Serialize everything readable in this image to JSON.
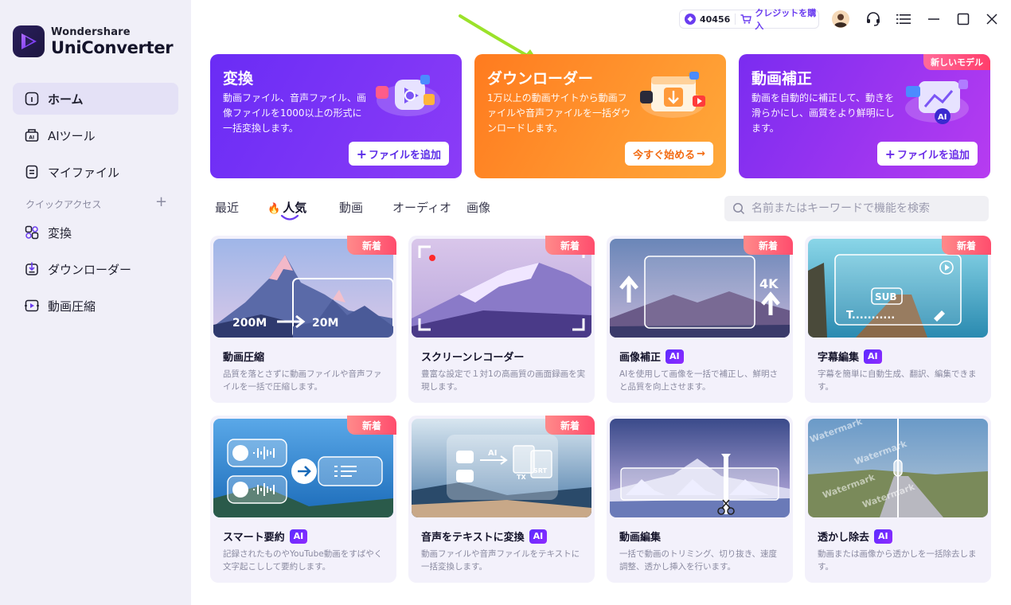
{
  "app": {
    "brand_small": "Wondershare",
    "brand_big": "UniConverter"
  },
  "sidebar": {
    "items": [
      {
        "label": "ホーム",
        "icon": "home-icon"
      },
      {
        "label": "AIツール",
        "icon": "ai-tools-icon"
      },
      {
        "label": "マイファイル",
        "icon": "my-files-icon"
      }
    ],
    "quick_access_label": "クイックアクセス",
    "quick_add": "+",
    "quick_items": [
      {
        "label": "変換",
        "icon": "convert-icon"
      },
      {
        "label": "ダウンローダー",
        "icon": "downloader-icon"
      },
      {
        "label": "動画圧縮",
        "icon": "compress-icon"
      }
    ]
  },
  "titlebar": {
    "credits": "40456",
    "buy_credits": "クレジットを購入"
  },
  "hero": [
    {
      "title": "変換",
      "desc": "動画ファイル、音声ファイル、画像ファイルを1000以上の形式に一括変換します。",
      "button": "ファイルを追加",
      "button_prefix": "+",
      "color_from": "#6a2cf5",
      "color_to": "#8b3cf7",
      "button_color": "#5b2de8"
    },
    {
      "title": "ダウンローダー",
      "desc": "1万以上の動画サイトから動画ファイルや音声ファイルを一括ダウンロードします。",
      "button": "今すぐ始める",
      "button_suffix": "→",
      "color_from": "#ff7b1f",
      "color_to": "#ffa93a",
      "button_color": "#f26b12"
    },
    {
      "title": "動画補正",
      "desc": "動画を自動的に補正して、動きを滑らかにし、画質をより鮮明にします。",
      "button": "ファイルを追加",
      "button_prefix": "+",
      "badge": "新しいモデル",
      "color_from": "#7a2cf0",
      "color_to": "#b73cf0",
      "button_color": "#6a2de8"
    }
  ],
  "tabs": {
    "items": [
      "最近",
      "人気",
      "動画",
      "オーディオ",
      "画像"
    ],
    "active": "人気",
    "fire_icon": "🔥"
  },
  "search": {
    "placeholder": "名前またはキーワードで機能を検索"
  },
  "cards": [
    {
      "title": "動画圧縮",
      "desc": "品質を落とさずに動画ファイルや音声ファイルを一括で圧縮します。",
      "badge": "新着",
      "ai": false,
      "from_label": "200M",
      "to_label": "20M"
    },
    {
      "title": "スクリーンレコーダー",
      "desc": "豊富な設定で１対1の高画質の画面録画を実現します。",
      "badge": "新着",
      "ai": false
    },
    {
      "title": "画像補正",
      "desc": "AIを使用して画像を一括で補正し、鮮明さと品質を向上させます。",
      "badge": "新着",
      "ai": true,
      "res_label": "4K"
    },
    {
      "title": "字幕編集",
      "desc": "字幕を簡単に自動生成、翻訳、編集できます。",
      "badge": "新着",
      "ai": true,
      "sub_label": "SUB",
      "t_label": "T..........."
    },
    {
      "title": "スマート要約",
      "desc": "記録されたものやYouTube動画をすばやく文字起こしして要約します。",
      "badge": "新着",
      "ai": true
    },
    {
      "title": "音声をテキストに変換",
      "desc": "動画ファイルや音声ファイルをテキストに一括変換します。",
      "badge": "新着",
      "ai": true,
      "ai_label": "AI",
      "tx_label": "TX",
      "srt_label": "SRT"
    },
    {
      "title": "動画編集",
      "desc": "一括で動画のトリミング、切り抜き、速度調整、透かし挿入を行います。",
      "badge": "",
      "ai": false
    },
    {
      "title": "透かし除去",
      "desc": "動画または画像から透かしを一括除去します。",
      "badge": "",
      "ai": true,
      "watermark_text": "Watermark"
    }
  ],
  "ai_label": "AI"
}
